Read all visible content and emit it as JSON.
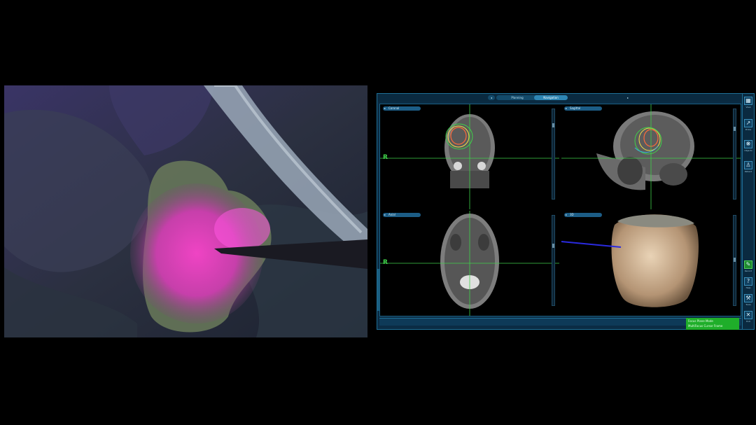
{
  "navigation": {
    "tabs": [
      {
        "label": "Planning"
      },
      {
        "label": "Navigation",
        "active": true
      }
    ],
    "viewports": [
      {
        "id": "coronal",
        "label": "Coronal"
      },
      {
        "id": "sagittal",
        "label": "Sagittal"
      },
      {
        "id": "axial",
        "label": "Axial"
      },
      {
        "id": "3d",
        "label": "3D"
      }
    ],
    "orientation_marker": "R",
    "sidebar": [
      {
        "icon": "layout-icon",
        "label": "View"
      },
      {
        "icon": "pointer-icon",
        "label": "Probe"
      },
      {
        "icon": "brain-icon",
        "label": "Objects"
      },
      {
        "icon": "person-icon",
        "label": "Patient"
      },
      {
        "icon": "green-tool-icon",
        "label": "Record"
      },
      {
        "icon": "help-icon",
        "label": "Help",
        "glyph": "?"
      },
      {
        "icon": "wrench-icon",
        "label": "Tools",
        "glyph": "⚒"
      },
      {
        "icon": "close-icon",
        "label": "Exit",
        "glyph": "✕"
      }
    ],
    "status_badge": {
      "line1": "Focus Plane Mode",
      "line2": "MultiFocus Cursor Frame"
    },
    "colors": {
      "panel": "#0b2c44",
      "accent": "#2e86b4",
      "crosshair": "#3fd24a",
      "status": "#1fae2a"
    }
  }
}
